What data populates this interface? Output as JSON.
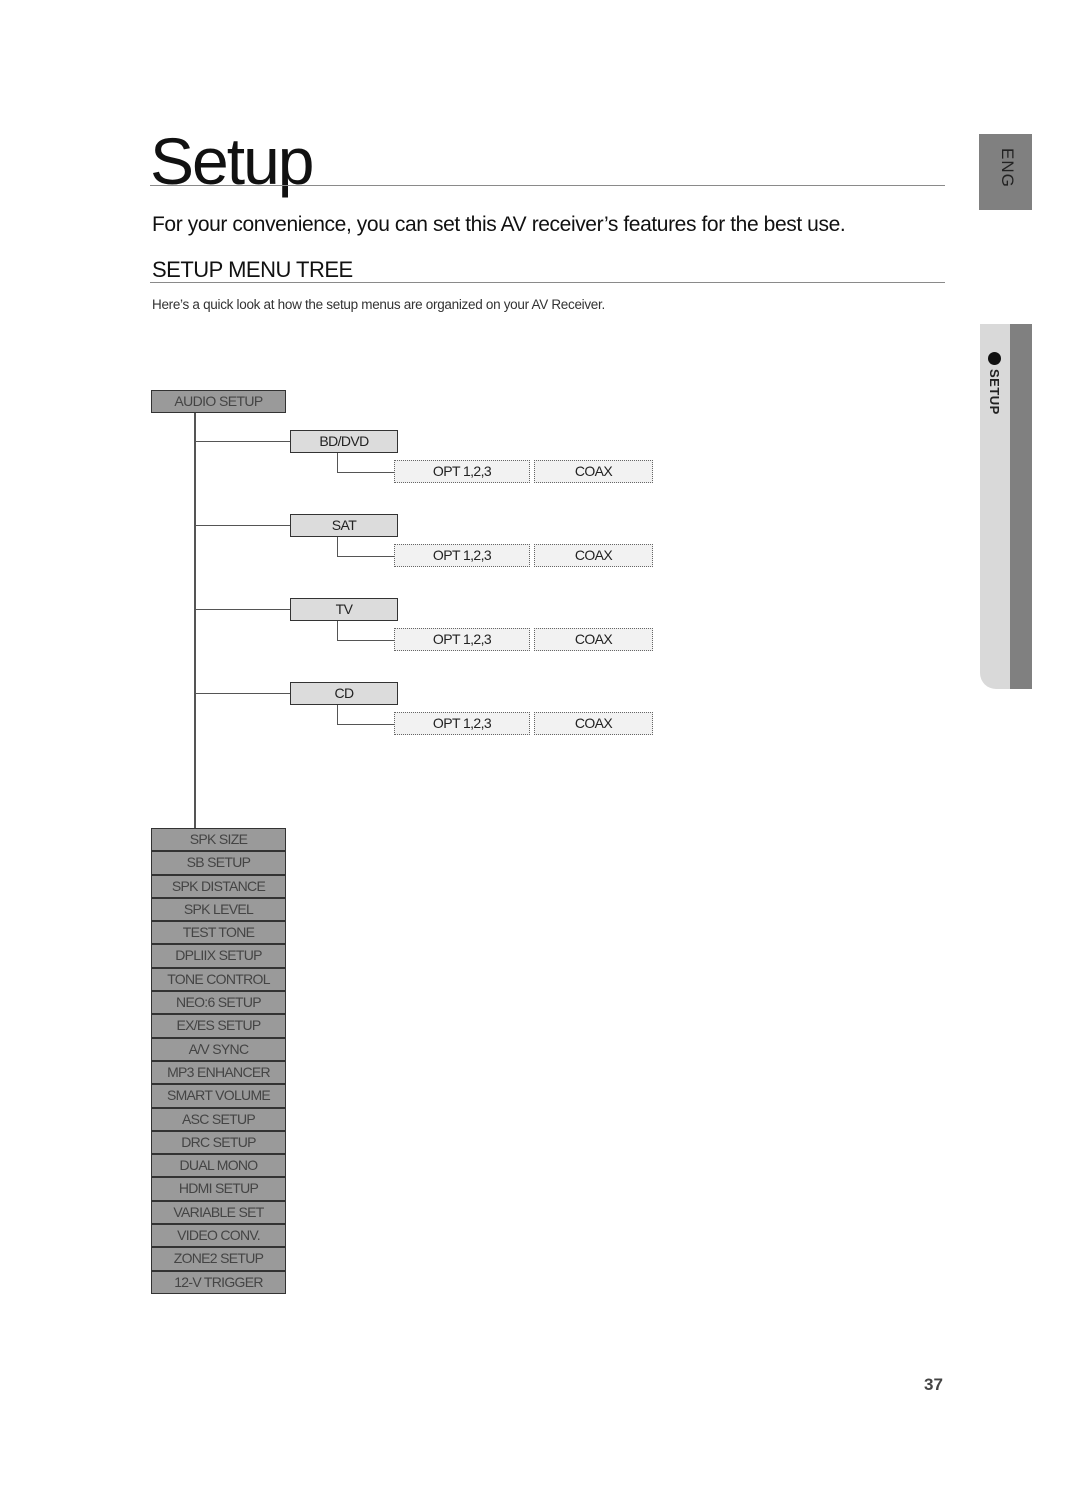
{
  "page": {
    "title": "Setup",
    "intro": "For your convenience, you can set this AV receiver’s features for the best use.",
    "section_heading": "SETUP MENU TREE",
    "description": "Here’s a quick look at how the setup menus are organized on your AV Receiver.",
    "page_number": "37"
  },
  "side_tabs": {
    "language": "ENG",
    "chapter": "SETUP",
    "chapter_marker_icon": "bullet-dot-icon"
  },
  "menu_tree": {
    "root": "AUDIO SETUP",
    "sources": [
      {
        "label": "BD/DVD",
        "options": [
          "OPT 1,2,3",
          "COAX"
        ]
      },
      {
        "label": "SAT",
        "options": [
          "OPT 1,2,3",
          "COAX"
        ]
      },
      {
        "label": "TV",
        "options": [
          "OPT 1,2,3",
          "COAX"
        ]
      },
      {
        "label": "CD",
        "options": [
          "OPT 1,2,3",
          "COAX"
        ]
      }
    ],
    "items": [
      "SPK SIZE",
      "SB SETUP",
      "SPK DISTANCE",
      "SPK LEVEL",
      "TEST TONE",
      "DPLIIX SETUP",
      "TONE CONTROL",
      "NEO:6 SETUP",
      "EX/ES SETUP",
      "A/V SYNC",
      "MP3 ENHANCER",
      "SMART VOLUME",
      "ASC SETUP",
      "DRC SETUP",
      "DUAL MONO",
      "HDMI SETUP",
      "VARIABLE SET",
      "VIDEO CONV.",
      "ZONE2 SETUP",
      "12-V TRIGGER"
    ]
  }
}
